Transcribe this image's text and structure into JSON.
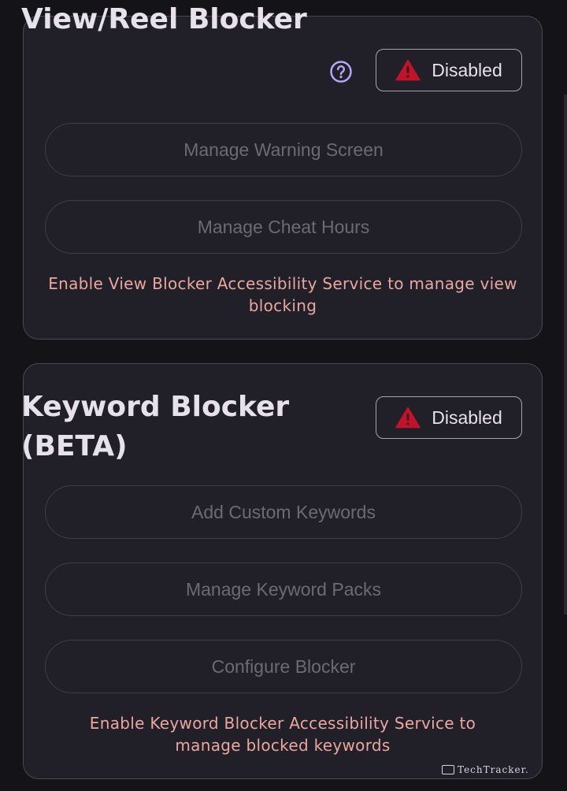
{
  "view_blocker": {
    "title": "View/Reel Blocker",
    "help_icon": "help-circle-icon",
    "status": {
      "label": "Disabled",
      "icon": "warning-triangle-icon",
      "icon_color": "#c0142a"
    },
    "buttons": [
      {
        "label": "Manage Warning Screen"
      },
      {
        "label": "Manage Cheat Hours"
      }
    ],
    "notice": "Enable View Blocker Accessibility Service to manage view blocking"
  },
  "keyword_blocker": {
    "title_line1": "Keyword Blocker",
    "title_line2": "(BETA)",
    "status": {
      "label": "Disabled",
      "icon": "warning-triangle-icon",
      "icon_color": "#c0142a"
    },
    "buttons": [
      {
        "label": "Add Custom Keywords"
      },
      {
        "label": "Manage Keyword Packs"
      },
      {
        "label": "Configure Blocker"
      }
    ],
    "notice": "Enable Keyword Blocker Accessibility Service to manage blocked keywords"
  },
  "watermark": {
    "text": "TechTracker."
  },
  "colors": {
    "background": "#141317",
    "card": "#211f28",
    "notice_text": "#eaa79e",
    "help_icon": "#b7a6f5"
  }
}
